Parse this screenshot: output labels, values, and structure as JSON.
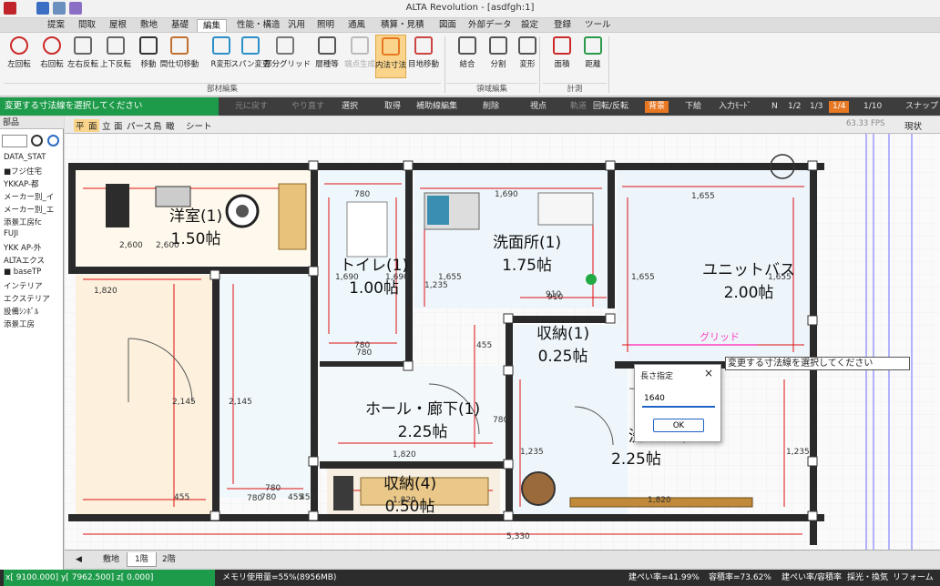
{
  "window": {
    "title": "ALTA Revolution - [asdfgh:1]"
  },
  "menu": [
    "提案",
    "間取",
    "屋根",
    "敷地",
    "基礎",
    "編集",
    "性能・構造",
    "汎用",
    "照明",
    "通風",
    "積算・見積",
    "図面",
    "外部データ",
    "設定",
    "登録",
    "ツール"
  ],
  "menu_active_index": 5,
  "ribbon": {
    "buttons": [
      "左回転",
      "右回転",
      "左右反転",
      "上下反転",
      "移動",
      "間仕切移動",
      "R変形",
      "スパン変更",
      "部分グリッド",
      "層種等",
      "端点生成",
      "内法寸法",
      "目地移動",
      "結合",
      "分割",
      "変形",
      "面積",
      "距離"
    ],
    "selected_index": 11,
    "disabled_index": 10,
    "groups": [
      "部材編集",
      "領域編集",
      "計測"
    ]
  },
  "status": {
    "message": "変更する寸法線を選択してください",
    "undo": "元に戻す",
    "redo": "やり直す",
    "select": "選択",
    "get": "取得",
    "aux_edit": "補助線編集",
    "delete": "削除",
    "viewpoint": "視点",
    "trajectory": "軌道",
    "rotate_flip": "回転/反転",
    "background": "背景",
    "underlay": "下絵",
    "input_mode": "入力ﾓｰﾄﾞ",
    "scales": [
      "N",
      "1/2",
      "1/3",
      "1/4",
      "1/10"
    ],
    "scale_active": "1/4",
    "snap": "スナップ"
  },
  "panel": {
    "header": "部品",
    "items": [
      "DATA_STAT",
      "■フジ住宅",
      "YKKAP-都",
      "メーカー別_イ",
      "メーカー別_エ",
      "添景工房fc",
      "FUJI",
      "YKK AP-外",
      "ALTAエクス",
      "■ baseTP",
      "インテリア",
      "エクステリア",
      "設備ｼﾝﾎﾞﾙ",
      "添景工房"
    ]
  },
  "viewbar": {
    "tabs": [
      "平",
      "面",
      "立",
      "面",
      "パース",
      "鳥",
      "瞰",
      "シート"
    ],
    "fps": "63.33 FPS",
    "mode": "現状"
  },
  "rooms": [
    {
      "name": "洋室(1)",
      "size": "1.50帖"
    },
    {
      "name": "トイレ(1)",
      "size": "1.00帖"
    },
    {
      "name": "洗面所(1)",
      "size": "1.75帖"
    },
    {
      "name": "ユニットバス",
      "size": "2.00帖"
    },
    {
      "name": "収納(1)",
      "size": "0.25帖"
    },
    {
      "name": "ホール・廊下(1)",
      "size": "2.25帖"
    },
    {
      "name": "洗",
      "size": "2.25帖"
    },
    {
      "name": "収納(4)",
      "size": "0.50帖"
    }
  ],
  "dimensions": [
    "2,600",
    "1,820",
    "780",
    "1,690",
    "1,655",
    "1,235",
    "910",
    "780",
    "1,690",
    "1,690",
    "1,655",
    "1,655",
    "1,655",
    "910",
    "780",
    "455",
    "780",
    "780",
    "2,145",
    "2,145",
    "455",
    "780",
    "455",
    "1,820",
    "1,820",
    "1,235",
    "1,235",
    "2,600",
    "5,330",
    "1,820",
    "780",
    "455"
  ],
  "grid_label": "グリッド",
  "dialog": {
    "title": "長さ指定",
    "value": "1640",
    "ok": "OK"
  },
  "tooltip": "変更する寸法線を選択してください",
  "bottom_tabs": [
    "敷地",
    "1階",
    "2階"
  ],
  "bottom_active": "1階",
  "footer": {
    "coords": "x[ 9100.000] y[ 7962.500] z[ 0.000]",
    "memory": "メモリ使用量=55%(8956MB)",
    "coverage": "建ぺい率=41.99%",
    "floor_ratio": "容積率=73.62%",
    "ratio": "建ぺい率/容積率",
    "ventilation": "採光・換気",
    "reform": "リフォーム"
  },
  "colors": {
    "accent": "#e87722",
    "status_green": "#1e9b4a",
    "dim_red": "#e01010",
    "wall": "#2a2a2a"
  }
}
